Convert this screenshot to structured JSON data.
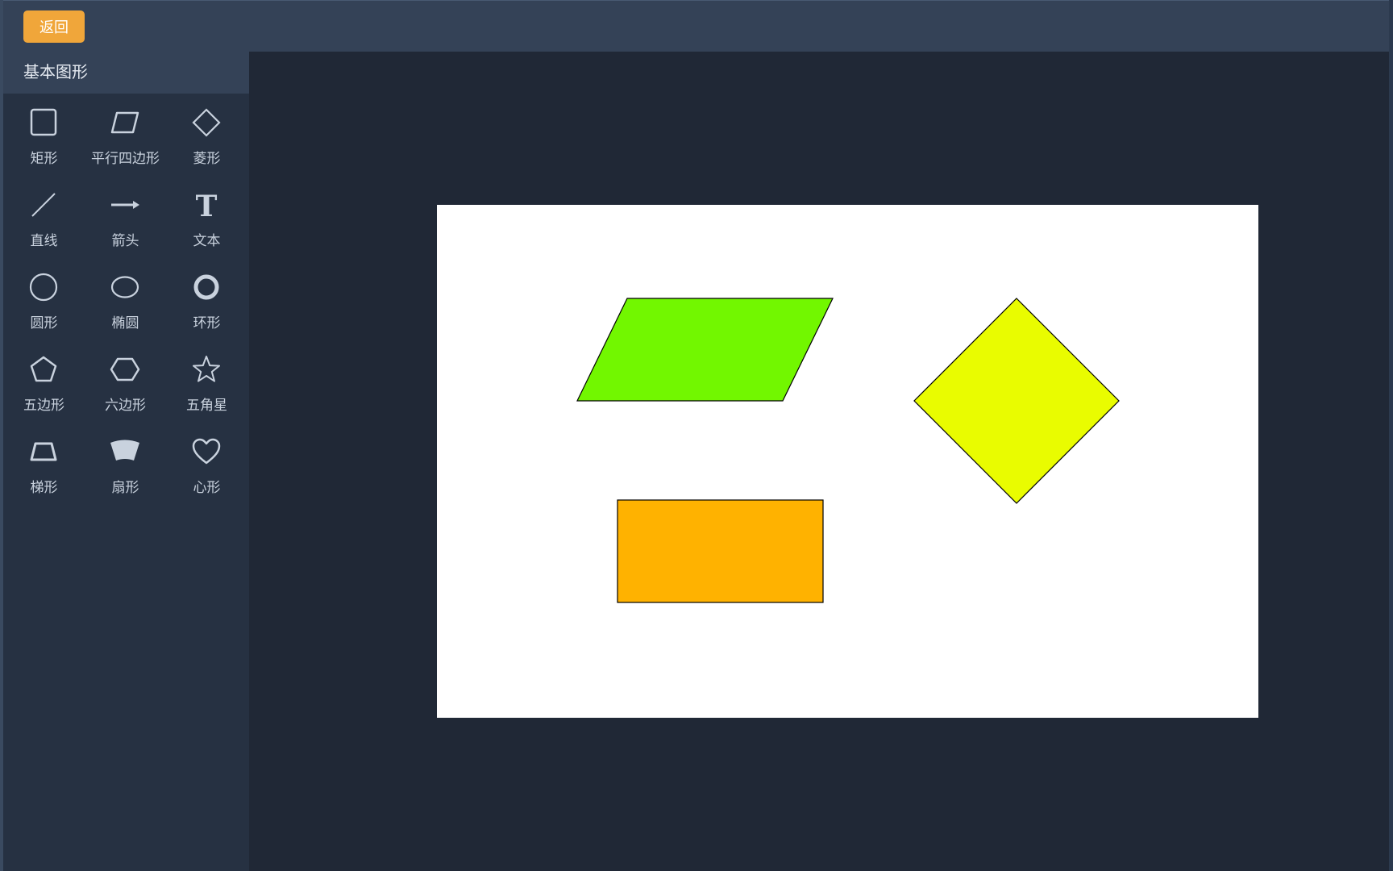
{
  "toolbar": {
    "back_label": "返回",
    "back_color": "#f0a63a"
  },
  "sidebar": {
    "title": "基本图形",
    "shapes": [
      {
        "label": "矩形",
        "icon": "rectangle-icon"
      },
      {
        "label": "平行四边形",
        "icon": "parallelogram-icon"
      },
      {
        "label": "菱形",
        "icon": "rhombus-icon"
      },
      {
        "label": "直线",
        "icon": "line-icon"
      },
      {
        "label": "箭头",
        "icon": "arrow-icon"
      },
      {
        "label": "文本",
        "icon": "text-icon"
      },
      {
        "label": "圆形",
        "icon": "circle-icon"
      },
      {
        "label": "椭圆",
        "icon": "ellipse-icon"
      },
      {
        "label": "环形",
        "icon": "ring-icon"
      },
      {
        "label": "五边形",
        "icon": "pentagon-icon"
      },
      {
        "label": "六边形",
        "icon": "hexagon-icon"
      },
      {
        "label": "五角星",
        "icon": "star-icon"
      },
      {
        "label": "梯形",
        "icon": "trapezoid-icon"
      },
      {
        "label": "扇形",
        "icon": "sector-icon"
      },
      {
        "label": "心形",
        "icon": "heart-icon"
      }
    ],
    "text_icon_glyph": "T"
  },
  "canvas": {
    "background": "#ffffff",
    "objects": [
      {
        "type": "parallelogram",
        "fill": "#72f700",
        "stroke": "#000000"
      },
      {
        "type": "rhombus",
        "fill": "#e9fc00",
        "stroke": "#000000"
      },
      {
        "type": "rectangle",
        "fill": "#ffb200",
        "stroke": "#000000"
      }
    ]
  }
}
